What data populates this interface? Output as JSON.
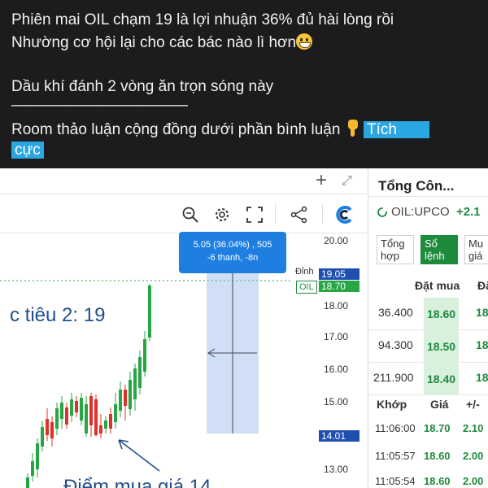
{
  "post": {
    "line1": "Phiên mai OIL chạm 19 là lợi nhuận 36% đủ hài lòng rồi",
    "line2": "Nhường cơ hội lại cho các bác nào lì hơn",
    "line3": "Dầu khí đánh 2 vòng ăn trọn sóng này",
    "divider": "————————————",
    "line4": "Room thảo luận cộng đồng dưới phần bình luận",
    "tag_part1": "Tích",
    "tag_part2": "cực",
    "emoji_icon": "grinning-face-icon",
    "hand_icon": "hand-pointing-down-icon"
  },
  "chart": {
    "topbar_plus": "+",
    "topbar_expand": "⤢",
    "toolbar_icons": [
      "zoom-icon",
      "gear-icon",
      "fullscreen-icon",
      "share-icon",
      "logo-icon"
    ],
    "price_ticks": [
      "20.00",
      "18.00",
      "17.00",
      "16.00",
      "15.00",
      "13.00"
    ],
    "label_dinh": "Đỉnh",
    "label_dinh_value": "19.05",
    "label_oil": "OIL",
    "label_oil_value": "18.70",
    "label_low_value": "14.01",
    "tooltip_line1": "5.05 (36.04%) , 505",
    "tooltip_line2": "-6 thanh, -8n",
    "annotation_target": "c tiêu 2: 19",
    "annotation_buy": "Điểm mua giá 14",
    "colors": {
      "up": "#27a644",
      "down": "#e0302a",
      "accent": "#1e7fe0",
      "annotation": "#1f4f8a"
    }
  },
  "panel": {
    "title": "Tổng Côn...",
    "symbol": "OIL:UPCO",
    "change": "+2.1",
    "tabs": [
      {
        "label": "Tổng\nhợp",
        "active": false
      },
      {
        "label": "Sổ\nlệnh",
        "active": true
      },
      {
        "label": "Mu\ngiá",
        "active": false
      }
    ],
    "book_header": "Đặt mua",
    "book_header2": "Đặ",
    "book": [
      {
        "qty": "36.400",
        "price": "18.60",
        "next": "18"
      },
      {
        "qty": "94.300",
        "price": "18.50",
        "next": "18"
      },
      {
        "qty": "211.900",
        "price": "18.40",
        "next": "18"
      }
    ],
    "trades_headers": [
      "Khớp",
      "Giá",
      "+/-"
    ],
    "trades": [
      {
        "time": "11:06:00",
        "price": "18.70",
        "change": "2.10"
      },
      {
        "time": "11:05:57",
        "price": "18.60",
        "change": "2.00"
      },
      {
        "time": "11:05:54",
        "price": "18.60",
        "change": "2.00"
      }
    ]
  }
}
